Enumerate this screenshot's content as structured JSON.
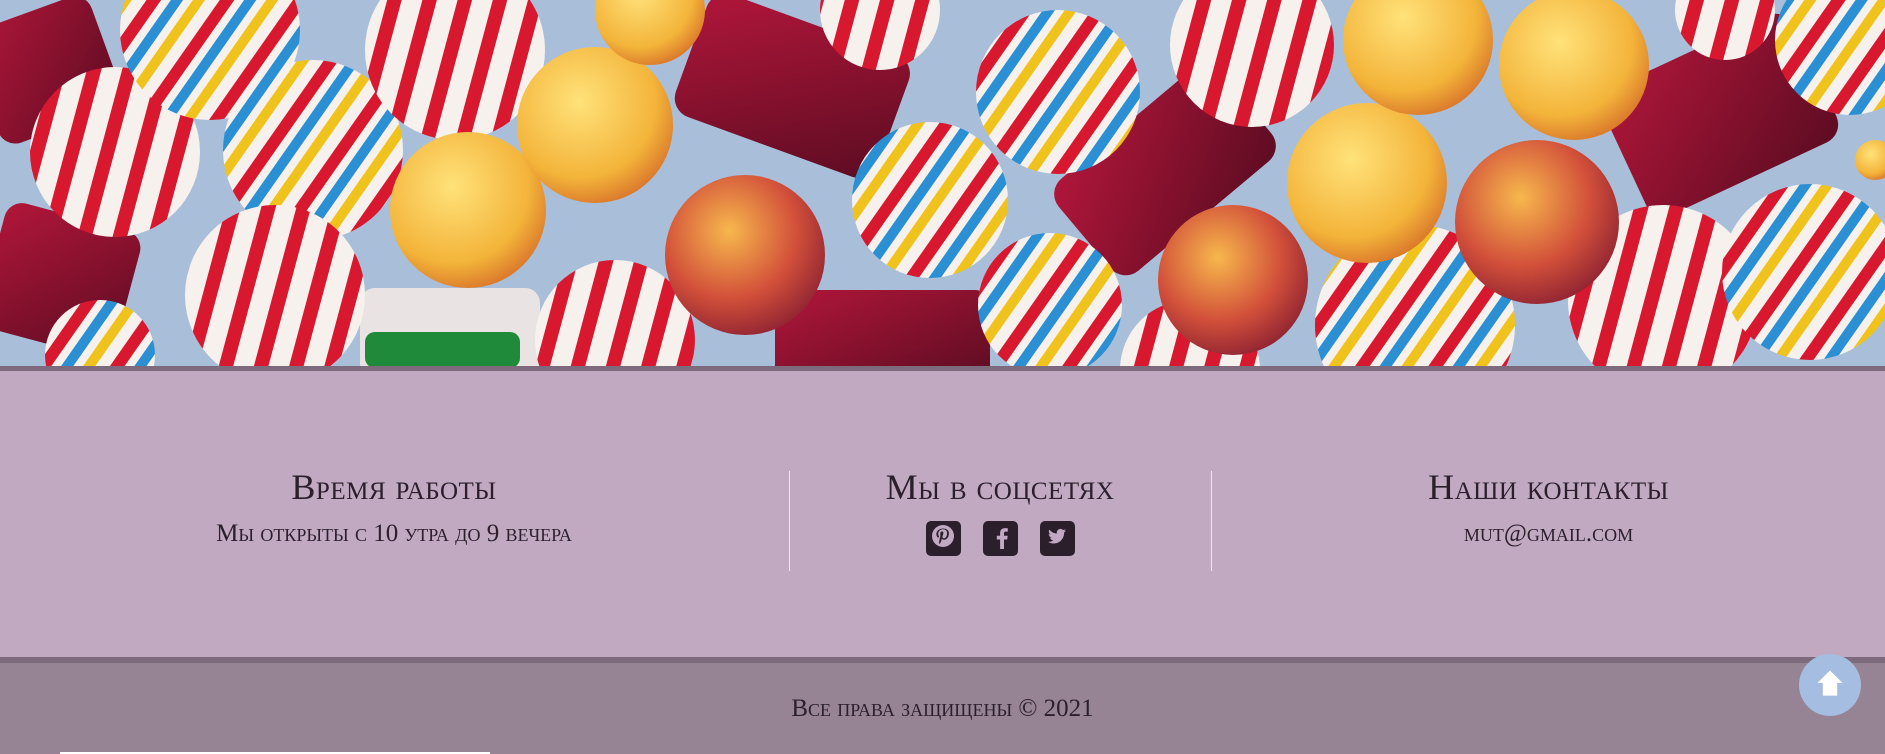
{
  "hero": {
    "icon": "candy-image"
  },
  "hours": {
    "title": "Время работы",
    "text": "Мы открыты с 10 утра до 9 вечера"
  },
  "social": {
    "title": "Мы в соцсетях",
    "links": [
      {
        "icon": "pinterest-icon"
      },
      {
        "icon": "facebook-icon"
      },
      {
        "icon": "twitter-icon"
      }
    ]
  },
  "contacts": {
    "title": "Наши контакты",
    "email": "mut@gmail.com"
  },
  "footer": {
    "copyright": "Все права защищены © 2021"
  },
  "scroll_top": {
    "icon": "arrow-up-icon"
  },
  "colors": {
    "band": "#c1a9c2",
    "footer": "#968494",
    "border": "#7d6a7d",
    "text": "#2b1f2c",
    "scroll_button": "#a4bde0"
  }
}
